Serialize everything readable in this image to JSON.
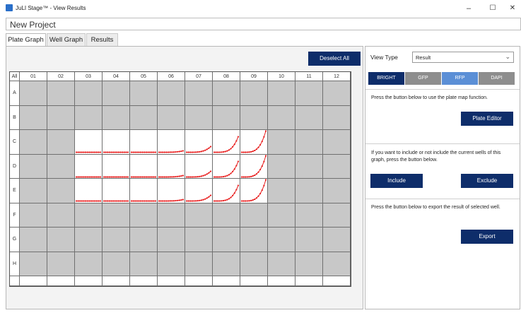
{
  "window": {
    "title": "JuLI Stage™ - View Results",
    "minimize": "–",
    "maximize": "☐",
    "close": "✕"
  },
  "project": {
    "name": "New Project"
  },
  "tabs": [
    {
      "label": "Plate Graph",
      "active": true
    },
    {
      "label": "Well Graph",
      "active": false
    },
    {
      "label": "Results",
      "active": false
    }
  ],
  "plate": {
    "deselect_label": "Deselect All",
    "corner": "All",
    "columns": [
      "01",
      "02",
      "03",
      "04",
      "05",
      "06",
      "07",
      "08",
      "09",
      "10",
      "11",
      "12"
    ],
    "rows": [
      "A",
      "B",
      "C",
      "D",
      "E",
      "F",
      "G",
      "H"
    ],
    "active_rows": [
      "C",
      "D",
      "E"
    ],
    "active_columns": [
      "03",
      "04",
      "05",
      "06",
      "07",
      "08",
      "09"
    ],
    "colors": {
      "inactive": "#c8c8c8",
      "active": "#ffffff",
      "curve": "#e81e1e"
    }
  },
  "right": {
    "view_type_label": "View Type",
    "view_type_value": "Result",
    "filters": [
      {
        "label": "BRIGHT",
        "color": "#0e2d6a"
      },
      {
        "label": "GFP",
        "color": "#8e8e8e"
      },
      {
        "label": "RFP",
        "color": "#5b8fd6"
      },
      {
        "label": "DAPI",
        "color": "#8e8e8e"
      }
    ],
    "plate_map_text": "Press the button below to use the plate map function.",
    "plate_editor_label": "Plate Editor",
    "include_text": "If you want to include or not include the current wells of this graph, press the button below.",
    "include_label": "Include",
    "exclude_label": "Exclude",
    "export_text": "Press the button below to export the result of selected well.",
    "export_label": "Export"
  }
}
